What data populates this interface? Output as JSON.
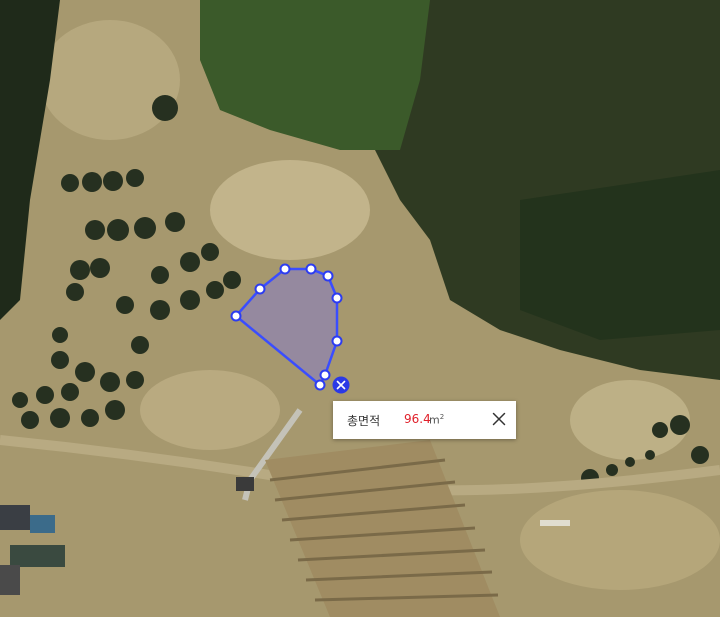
{
  "map": {
    "layer": "satellite-imagery",
    "polygon_fill": "#8a7fc0",
    "polygon_stroke": "#3a4dff",
    "vertex_fill": "#ffffff",
    "vertex_stroke": "#2c3cf0"
  },
  "measure_popup": {
    "label": "총면적",
    "value": "96.4",
    "unit": "m",
    "unit_sup": "2",
    "close_icon": "close-icon"
  },
  "delete_button": {
    "icon": "close-circle-icon",
    "color": "#2b39e6"
  }
}
